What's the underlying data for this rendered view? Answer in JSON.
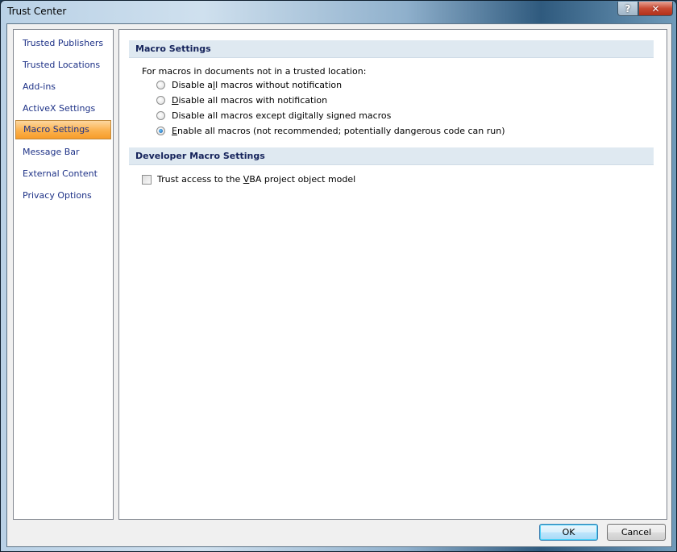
{
  "window": {
    "title": "Trust Center",
    "help_label": "?",
    "close_label": "✕"
  },
  "sidebar": {
    "items": [
      {
        "label": "Trusted Publishers",
        "active": false
      },
      {
        "label": "Trusted Locations",
        "active": false
      },
      {
        "label": "Add-ins",
        "active": false
      },
      {
        "label": "ActiveX Settings",
        "active": false
      },
      {
        "label": "Macro Settings",
        "active": true
      },
      {
        "label": "Message Bar",
        "active": false
      },
      {
        "label": "External Content",
        "active": false
      },
      {
        "label": "Privacy Options",
        "active": false
      }
    ]
  },
  "macro_settings": {
    "header": "Macro Settings",
    "intro": "For macros in documents not in a trusted location:",
    "options": [
      {
        "pre": "Disable a",
        "accel": "l",
        "post": "l macros without notification",
        "checked": false
      },
      {
        "pre": "",
        "accel": "D",
        "post": "isable all macros with notification",
        "checked": false
      },
      {
        "pre": "Disable all macros except di",
        "accel": "g",
        "post": "itally signed macros",
        "checked": false
      },
      {
        "pre": "",
        "accel": "E",
        "post": "nable all macros (not recommended; potentially dangerous code can run)",
        "checked": true
      }
    ]
  },
  "developer_settings": {
    "header": "Developer Macro Settings",
    "vba_access": {
      "pre": "Trust access to the ",
      "accel": "V",
      "post": "BA project object model",
      "checked": false
    }
  },
  "footer": {
    "ok_label": "OK",
    "cancel_label": "Cancel"
  }
}
